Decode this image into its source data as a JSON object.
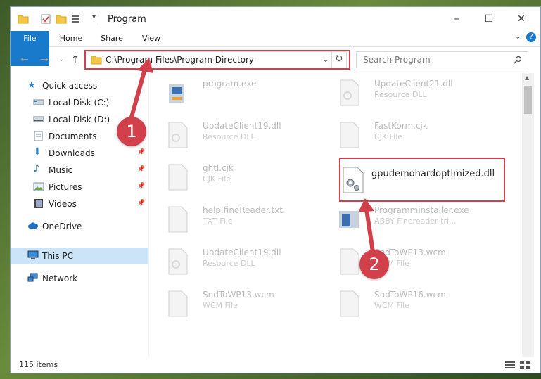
{
  "window": {
    "title": "Program",
    "controls": {
      "minimize": "–",
      "maximize": "☐",
      "close": "✕"
    }
  },
  "ribbon": {
    "tabs": [
      "File",
      "Home",
      "Share",
      "View"
    ]
  },
  "address": {
    "path": "C:\\Program Files\\Program Directory",
    "search_placeholder": "Search Program"
  },
  "sidebar": {
    "items": [
      {
        "label": "Quick access",
        "icon": "star-icon",
        "pinned": false
      },
      {
        "label": "Local Disk (C:)",
        "icon": "drive-icon",
        "pinned": false
      },
      {
        "label": "Local Disk (D:)",
        "icon": "drive-icon",
        "pinned": false
      },
      {
        "label": "Documents",
        "icon": "documents-icon",
        "pinned": false
      },
      {
        "label": "Downloads",
        "icon": "download-icon",
        "pinned": true
      },
      {
        "label": "Music",
        "icon": "music-icon",
        "pinned": true
      },
      {
        "label": "Pictures",
        "icon": "pictures-icon",
        "pinned": true
      },
      {
        "label": "Videos",
        "icon": "videos-icon",
        "pinned": true
      },
      {
        "label": "OneDrive",
        "icon": "cloud-icon",
        "pinned": false
      },
      {
        "label": "This PC",
        "icon": "computer-icon",
        "pinned": false,
        "selected": true
      },
      {
        "label": "Network",
        "icon": "network-icon",
        "pinned": false
      }
    ]
  },
  "files": [
    {
      "name": "program.exe",
      "type": ""
    },
    {
      "name": "UpdateClient21.dll",
      "type": "Resource DLL"
    },
    {
      "name": "UpdateClient19.dll",
      "type": "Resource DLL"
    },
    {
      "name": "FastKorm.cjk",
      "type": "CJK File"
    },
    {
      "name": "ghtl.cjk",
      "type": "CJK File"
    },
    {
      "name": "gpudemohardoptimized.dll",
      "type": "",
      "highlighted": true
    },
    {
      "name": "help.fineReader.txt",
      "type": "TXT File"
    },
    {
      "name": "Programminstaller.exe",
      "type": "ABBY Finereader tri..."
    },
    {
      "name": "UpdateClient19.dll",
      "type": "Resource DLL"
    },
    {
      "name": "SndToWP13.wcm",
      "type": "WCM File"
    },
    {
      "name": "SndToWP13.wcm",
      "type": "WCM File"
    },
    {
      "name": "SndToWP16.wcm",
      "type": "WCM File"
    }
  ],
  "status": {
    "item_count": "115 items"
  },
  "markers": [
    "1",
    "2"
  ],
  "colors": {
    "accent": "#1979ca",
    "highlight_box": "#d2414b",
    "selected_bg": "#cce4f7"
  }
}
